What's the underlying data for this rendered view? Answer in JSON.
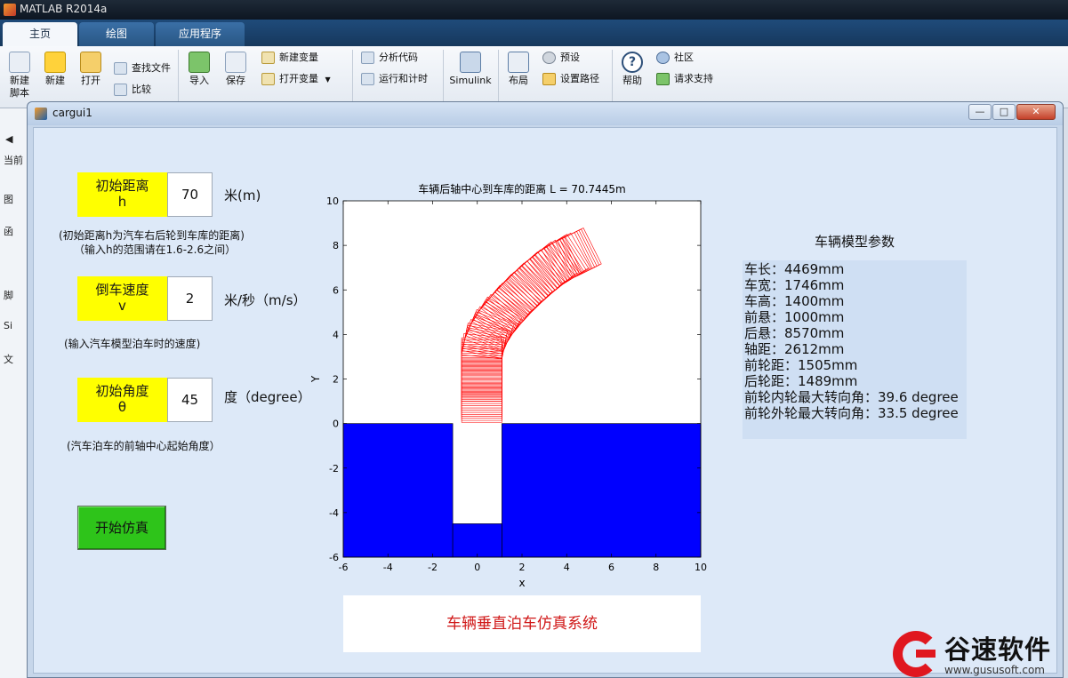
{
  "app": {
    "title": "MATLAB R2014a"
  },
  "ribbon": {
    "tabs": [
      "主页",
      "绘图",
      "应用程序"
    ],
    "buttons": {
      "new_script": "新建\n脚本",
      "new": "新建",
      "open": "打开",
      "find_files": "查找文件",
      "compare": "比较",
      "import": "导入",
      "save": "保存",
      "new_variable": "新建变量",
      "open_variable": "打开变量",
      "analyze_code": "分析代码",
      "run_and_time": "运行和计时",
      "simulink": "Simulink",
      "layout": "布局",
      "preferences": "预设",
      "set_path": "设置路径",
      "help": "帮助",
      "community": "社区",
      "request_support": "请求支持"
    },
    "left_items": [
      "当前",
      "图",
      "函",
      "脚",
      "Si",
      "文"
    ]
  },
  "figure": {
    "title": "cargui1",
    "window_buttons": [
      "—",
      "□",
      "✕"
    ]
  },
  "controls": {
    "distance": {
      "label_line1": "初始距离",
      "label_line2": "h",
      "value": "70",
      "unit": "米(m)",
      "note_line1": "(初始距离h为汽车右后轮到车库的距离)",
      "note_line2": "（输入h的范围请在1.6-2.6之间）"
    },
    "speed": {
      "label_line1": "倒车速度",
      "label_line2": "v",
      "value": "2",
      "unit": "米/秒（m/s）",
      "note": "(输入汽车模型泊车时的速度)"
    },
    "angle": {
      "label_line1": "初始角度",
      "label_line2": "θ",
      "value": "45",
      "unit": "度（degree）",
      "note": "(汽车泊车的前轴中心起始角度）"
    },
    "start_button": "开始仿真"
  },
  "system_title": "车辆垂直泊车仿真系统",
  "params": {
    "heading": "车辆模型参数",
    "lines": [
      "车长：4469mm",
      "车宽：1746mm",
      "车高：1400mm",
      "前悬：1000mm",
      "后悬：8570mm",
      "轴距：2612mm",
      "前轮距：1505mm",
      "后轮距：1489mm",
      "前轮内轮最大转向角：39.6 degree",
      "前轮外轮最大转向角：33.5 degree"
    ]
  },
  "chart_data": {
    "type": "line",
    "title": "车辆后轴中心到车库的距离 L = 70.7445m",
    "xlabel": "x",
    "ylabel": "Y",
    "xlim": [
      -6,
      10
    ],
    "ylim": [
      -6,
      10
    ],
    "xticks": [
      -6,
      -4,
      -2,
      0,
      2,
      4,
      6,
      8,
      10
    ],
    "yticks": [
      -6,
      -4,
      -2,
      0,
      2,
      4,
      6,
      8,
      10
    ],
    "colors": {
      "ground": "#0000ff",
      "track": "#ff0000",
      "garage": "#ffffff",
      "background": "#ffffff"
    },
    "ground_blocks": [
      {
        "x": [
          -6,
          -1.1
        ],
        "y": [
          -6,
          0
        ]
      },
      {
        "x": [
          1.1,
          10
        ],
        "y": [
          -6,
          0
        ]
      },
      {
        "x": [
          -1.1,
          1.1
        ],
        "y": [
          -6,
          -4.5
        ]
      }
    ],
    "vehicle_path": {
      "center": [
        [
          0.2,
          0.05
        ],
        [
          0.2,
          0.5
        ],
        [
          0.2,
          1.0
        ],
        [
          0.2,
          1.5
        ],
        [
          0.2,
          2.0
        ],
        [
          0.2,
          2.5
        ],
        [
          0.2,
          3.0
        ],
        [
          0.3,
          3.5
        ],
        [
          0.5,
          4.0
        ],
        [
          0.8,
          4.5
        ],
        [
          1.2,
          5.0
        ],
        [
          1.65,
          5.5
        ],
        [
          2.15,
          6.0
        ],
        [
          2.7,
          6.5
        ],
        [
          3.25,
          6.95
        ],
        [
          3.8,
          7.3
        ],
        [
          4.3,
          7.55
        ]
      ],
      "car_length": 0.95,
      "car_width": 1.8
    }
  }
}
